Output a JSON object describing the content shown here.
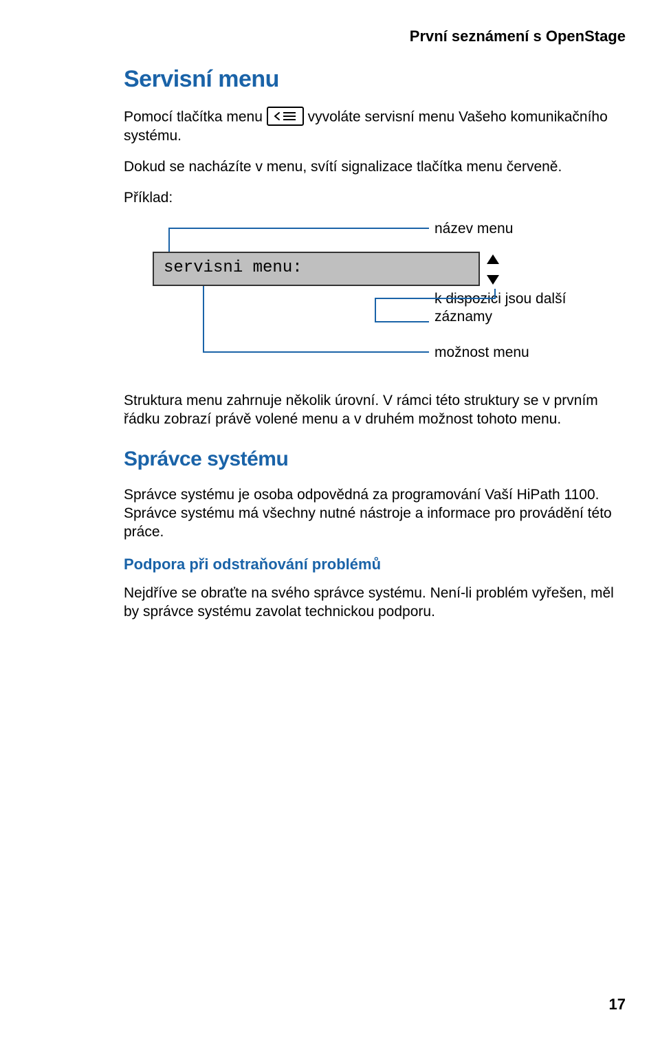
{
  "header": {
    "title": "První seznámení s OpenStage"
  },
  "section1": {
    "heading": "Servisní menu",
    "p1_a": "Pomocí tlačítka menu ",
    "p1_b": " vyvoláte servisní menu Vašeho komunikačního systému.",
    "p2": "Dokud se nacházíte v menu, svítí signalizace tlačítka menu červeně.",
    "example_label": "Příklad:",
    "p_struct": "Struktura menu zahrnuje několik úrovní. V rámci této struktury se v prvním řádku zobrazí právě volené menu a v druhém možnost tohoto menu."
  },
  "diagram": {
    "nazev_menu": "název menu",
    "servisni_menu": "servisni menu:",
    "k_dispozici_l1": "k dispozici jsou další",
    "k_dispozici_l2": "záznamy",
    "moznost_menu": "možnost menu"
  },
  "section2": {
    "heading": "Správce systému",
    "p1": "Správce systému je osoba odpovědná za programování Vaší HiPath 1100. Správce systému má všechny nutné nástroje a informace pro provádění této práce.",
    "sub_heading": "Podpora při odstraňování problémů",
    "p2": "Nejdříve se obraťte na svého správce systému. Není-li problém vyřešen, měl by správce systému zavolat technickou podporu."
  },
  "page_number": "17"
}
